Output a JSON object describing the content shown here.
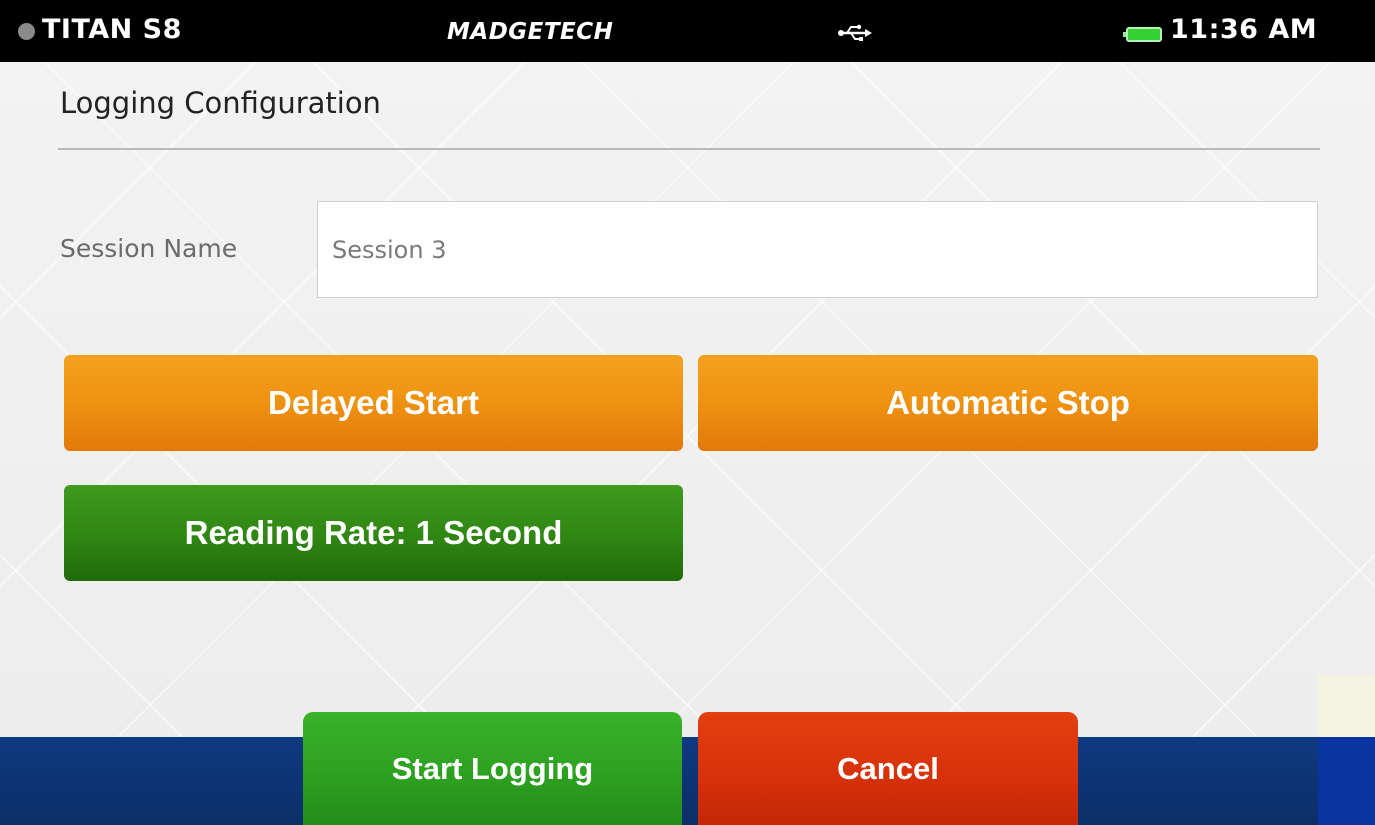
{
  "status_bar": {
    "device_name": "TITAN S8",
    "brand": "MADGETECH",
    "usb_icon": "usb-icon",
    "battery_icon": "battery-icon",
    "battery_color": "#33d133",
    "time": "11:36 AM"
  },
  "page": {
    "title": "Logging Configuration"
  },
  "session": {
    "label": "Session Name",
    "value": "Session 3"
  },
  "buttons": {
    "delayed_start": "Delayed Start",
    "automatic_stop": "Automatic Stop",
    "reading_rate": "Reading Rate: 1 Second",
    "start_logging": "Start Logging",
    "cancel": "Cancel"
  },
  "colors": {
    "orange": "#ef9412",
    "green": "#2f8613",
    "start_green": "#2ea322",
    "cancel_red": "#d9330b",
    "bottom_bar": "#0e3a80"
  }
}
